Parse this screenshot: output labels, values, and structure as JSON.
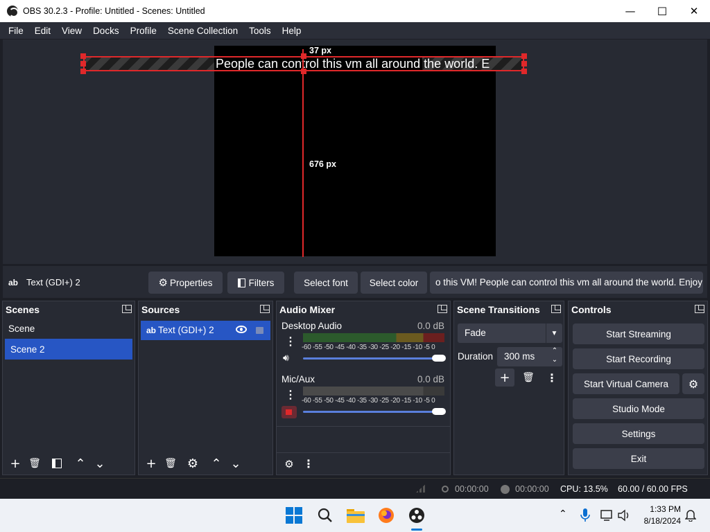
{
  "window": {
    "title": "OBS 30.2.3 - Profile: Untitled - Scenes: Untitled",
    "minimize": "—",
    "maximize": "☐",
    "close": "✕"
  },
  "menu": [
    "File",
    "Edit",
    "View",
    "Docks",
    "Profile",
    "Scene Collection",
    "Tools",
    "Help"
  ],
  "preview": {
    "text_content": "People can control this vm all around the world. E",
    "top_distance": "37 px",
    "bottom_distance": "676 px"
  },
  "properties_bar": {
    "source_icon": "ab",
    "source_name": "Text (GDI+) 2",
    "properties_label": "Properties",
    "filters_label": "Filters",
    "select_font_label": "Select font",
    "select_color_label": "Select color",
    "text_value": "o this VM! People can control this vm all around the world. Enjoy"
  },
  "docks": {
    "scenes": {
      "title": "Scenes",
      "items": [
        {
          "label": "Scene",
          "selected": false
        },
        {
          "label": "Scene 2",
          "selected": true
        }
      ]
    },
    "sources": {
      "title": "Sources",
      "items": [
        {
          "icon": "ab",
          "label": "Text (GDI+) 2"
        }
      ]
    },
    "audio_mixer": {
      "title": "Audio Mixer",
      "channels": [
        {
          "name": "Desktop Audio",
          "db": "0.0 dB",
          "muted": false
        },
        {
          "name": "Mic/Aux",
          "db": "0.0 dB",
          "muted": true
        }
      ],
      "scale": "-60 -55 -50 -45 -40 -35 -30 -25 -20 -15 -10 -5 0"
    },
    "transitions": {
      "title": "Scene Transitions",
      "selected": "Fade",
      "duration_label": "Duration",
      "duration_value": "300 ms"
    },
    "controls": {
      "title": "Controls",
      "start_streaming": "Start Streaming",
      "start_recording": "Start Recording",
      "start_virtual_camera": "Start Virtual Camera",
      "studio_mode": "Studio Mode",
      "settings": "Settings",
      "exit": "Exit"
    }
  },
  "status": {
    "stream_time": "00:00:00",
    "record_time": "00:00:00",
    "cpu": "CPU: 13.5%",
    "fps": "60.00 / 60.00 FPS"
  },
  "taskbar": {
    "time": "1:33 PM",
    "date": "8/18/2024"
  },
  "colors": {
    "accent": "#2756c4",
    "selection_red": "#e0282a",
    "panel": "#272a33",
    "background": "#1d1f26"
  }
}
